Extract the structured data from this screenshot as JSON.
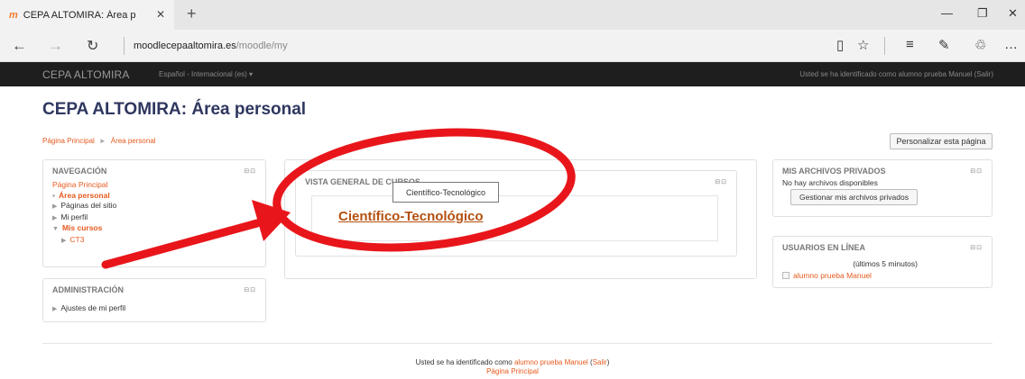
{
  "browser": {
    "tab_icon": "moodle-m-icon",
    "tab_favicon": "m",
    "tab_title": "CEPA ALTOMIRA: Área p",
    "url_host": "moodlecepaaltomira.es",
    "url_path": "/moodle/my"
  },
  "navbar": {
    "brand": "CEPA ALTOMIRA",
    "language": "Español - Internacional (es) ▾",
    "login_info": "Usted se ha identificado como alumno prueba Manuel (Salir)"
  },
  "page": {
    "title": "CEPA ALTOMIRA: Área personal",
    "breadcrumb": [
      "Página Principal",
      "Área personal"
    ],
    "customize_button": "Personalizar esta página"
  },
  "navigation": {
    "title": "NAVEGACIÓN",
    "home": "Página Principal",
    "personal_area": "Área personal",
    "site_pages": "Páginas del sitio",
    "profile": "Mi perfil",
    "my_courses": "Mis cursos",
    "course_ct3": "CT3"
  },
  "administration": {
    "title": "ADMINISTRACIÓN",
    "profile_settings": "Ajustes de mi perfil"
  },
  "course_overview": {
    "title": "VISTA GENERAL DE CURSOS",
    "course_name": "Científico-Tecnológico",
    "tooltip": "Científico-Tecnológico"
  },
  "private_files": {
    "title": "MIS ARCHIVOS PRIVADOS",
    "empty_text": "No hay archivos disponibles",
    "manage_button": "Gestionar mis archivos privados"
  },
  "online_users": {
    "title": "USUARIOS EN LÍNEA",
    "period": "(últimos 5 minutos)",
    "user": "alumno prueba Manuel"
  },
  "footer": {
    "prefix": "Usted se ha identificado como",
    "user": "alumno prueba Manuel",
    "logout": "Salir",
    "home": "Página Principal"
  },
  "colors": {
    "accent": "#e65a1e",
    "navbar": "#1e1e1e",
    "title": "#2f3760",
    "annotation": "#e8161b"
  }
}
